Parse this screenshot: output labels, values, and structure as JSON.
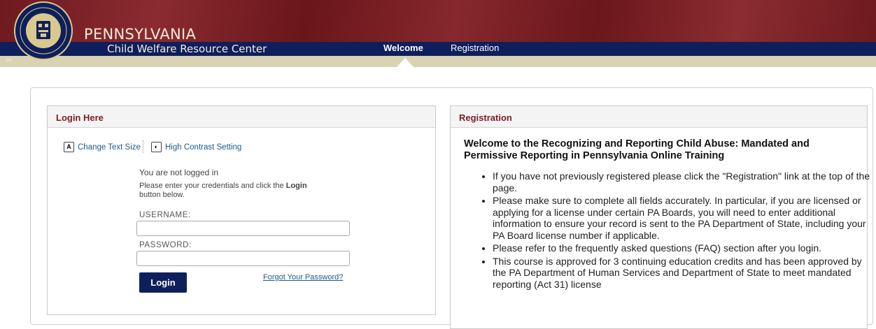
{
  "header": {
    "brand_line1": "PENNSYLVANIA",
    "brand_line2": "Child Welfare Resource Center",
    "seal_icon": "university-of-pittsburgh-seal",
    "nav": [
      {
        "label": "Welcome",
        "active": true
      },
      {
        "label": "Registration",
        "active": false
      }
    ],
    "colors": {
      "maroon": "#7a1f24",
      "navy": "#0f1f5c",
      "tan": "#d9d3b3"
    }
  },
  "login": {
    "title": "Login Here",
    "change_text_size": "Change Text Size",
    "high_contrast": "High Contrast Setting",
    "not_logged_in": "You are not logged in",
    "instructions_pre": "Please enter your credentials and click the ",
    "instructions_bold": "Login",
    "instructions_post": "button below.",
    "username_label": "USERNAME:",
    "username_value": "",
    "password_label": "PASSWORD:",
    "password_value": "",
    "login_button": "Login",
    "forgot_password": "Forgot Your Password?"
  },
  "registration": {
    "title": "Registration",
    "heading": "Welcome to the Recognizing and Reporting Child Abuse: Mandated and Permissive Reporting in Pennsylvania Online Training",
    "items": [
      "If you have not previously registered please click the \"Registration\" link at the top of the page.",
      "Please make sure to complete all fields accurately. In particular, if you are licensed or applying for a license under certain PA Boards, you will need to enter additional information to ensure your record is sent to the PA Department of State, including your PA Board license number if applicable.",
      "Please refer to the frequently asked questions (FAQ) section after you login.",
      "This course is approved for 3 continuing education credits and has been approved by the PA Department of Human Services and Department of State to meet mandated reporting (Act 31) license"
    ]
  }
}
